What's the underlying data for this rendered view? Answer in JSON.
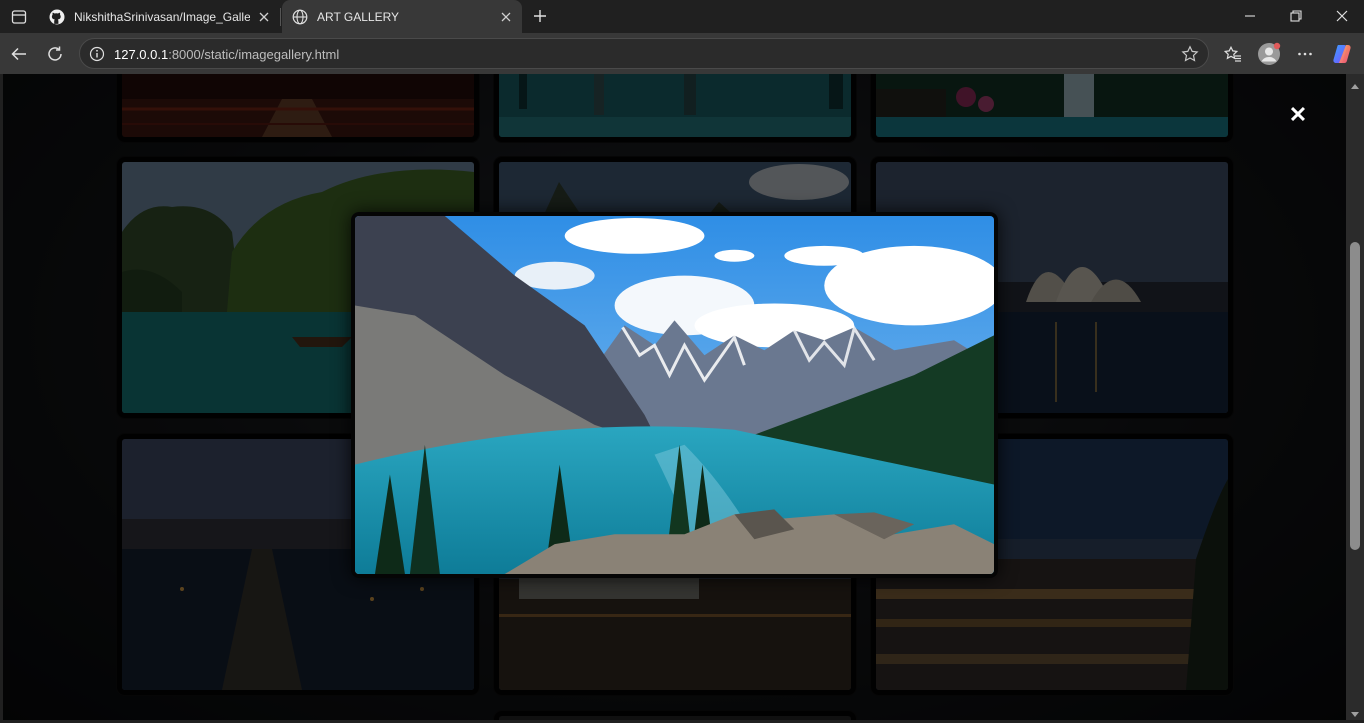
{
  "browser": {
    "tabs": [
      {
        "title": "NikshithaSrinivasan/Image_Gallery",
        "favicon": "github-icon",
        "active": false
      },
      {
        "title": "ART GALLERY",
        "favicon": "globe-icon",
        "active": true
      }
    ],
    "address": {
      "host": "127.0.0.1",
      "rest": ":8000/static/imagegallery.html"
    },
    "icons": [
      "tab-actions-icon",
      "new-tab-icon",
      "minimize-icon",
      "restore-icon",
      "close-window-icon",
      "back-icon",
      "refresh-icon",
      "site-info-icon",
      "favorite-star-icon",
      "favorites-icon",
      "profile-icon",
      "more-icon",
      "copilot-icon"
    ]
  },
  "gallery": {
    "images": [
      "red-bridge",
      "seaside-pillars",
      "waterfall-lagoon",
      "limestone-bay",
      "mountain-valley",
      "opera-house-night",
      "city-bridge-dusk",
      "riverside-palace",
      "city-lights-panorama"
    ],
    "overlay_close": "✕",
    "lightbox_image": "moraine-lake-mountains"
  },
  "scrollbar": {
    "position_fraction": 0.26,
    "thumb_fraction": 0.48
  },
  "colors": {
    "accent": "#40b0e6",
    "overlay": "#000000"
  }
}
